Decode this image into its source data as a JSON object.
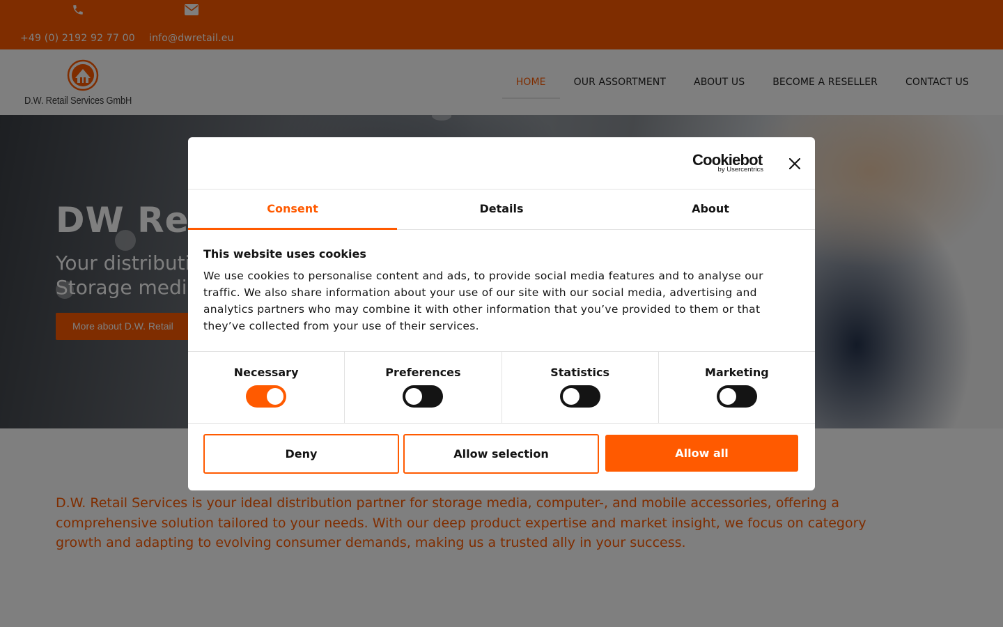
{
  "colors": {
    "accent": "#ff5a00",
    "dark": "#141414"
  },
  "topbar": {
    "phone_icon": "phone-icon",
    "mail_icon": "mail-icon",
    "phone": "+49 (0) 2192 92 77 00",
    "email": "info@dwretail.eu"
  },
  "header": {
    "logo_text": "D.W. Retail Services GmbH",
    "nav": [
      {
        "label": "HOME",
        "active": true
      },
      {
        "label": "OUR ASSORTMENT"
      },
      {
        "label": "ABOUT US"
      },
      {
        "label": "BECOME A RESELLER"
      },
      {
        "label": "CONTACT US"
      }
    ]
  },
  "hero": {
    "title": "DW Retail Services",
    "subtitle_line1": "Your distribution partner for",
    "subtitle_line2": "Storage media",
    "button": "More about D.W. Retail"
  },
  "intro": "D.W. Retail Services is your ideal distribution partner for storage media, computer-, and mobile accessories, offering a comprehensive solution tailored to your needs. With our deep product expertise and market insight, we focus on category growth and adapting to evolving consumer demands, making us a trusted ally in your success.",
  "cookie_dialog": {
    "brand": "Cookiebot",
    "brand_by": "by Usercentrics",
    "close_icon": "close-icon",
    "tabs": [
      {
        "label": "Consent",
        "active": true
      },
      {
        "label": "Details"
      },
      {
        "label": "About"
      }
    ],
    "title": "This website uses cookies",
    "text": "We use cookies to personalise content and ads, to provide social media features and to analyse our traffic. We also share information about your use of our site with our social media, advertising and analytics partners who may combine it with other information that you’ve provided to them or that they’ve collected from your use of their services.",
    "toggles": [
      {
        "label": "Necessary",
        "on": true
      },
      {
        "label": "Preferences",
        "on": false
      },
      {
        "label": "Statistics",
        "on": false
      },
      {
        "label": "Marketing",
        "on": false
      }
    ],
    "buttons": {
      "deny": "Deny",
      "allow_selection": "Allow selection",
      "allow_all": "Allow all"
    }
  }
}
